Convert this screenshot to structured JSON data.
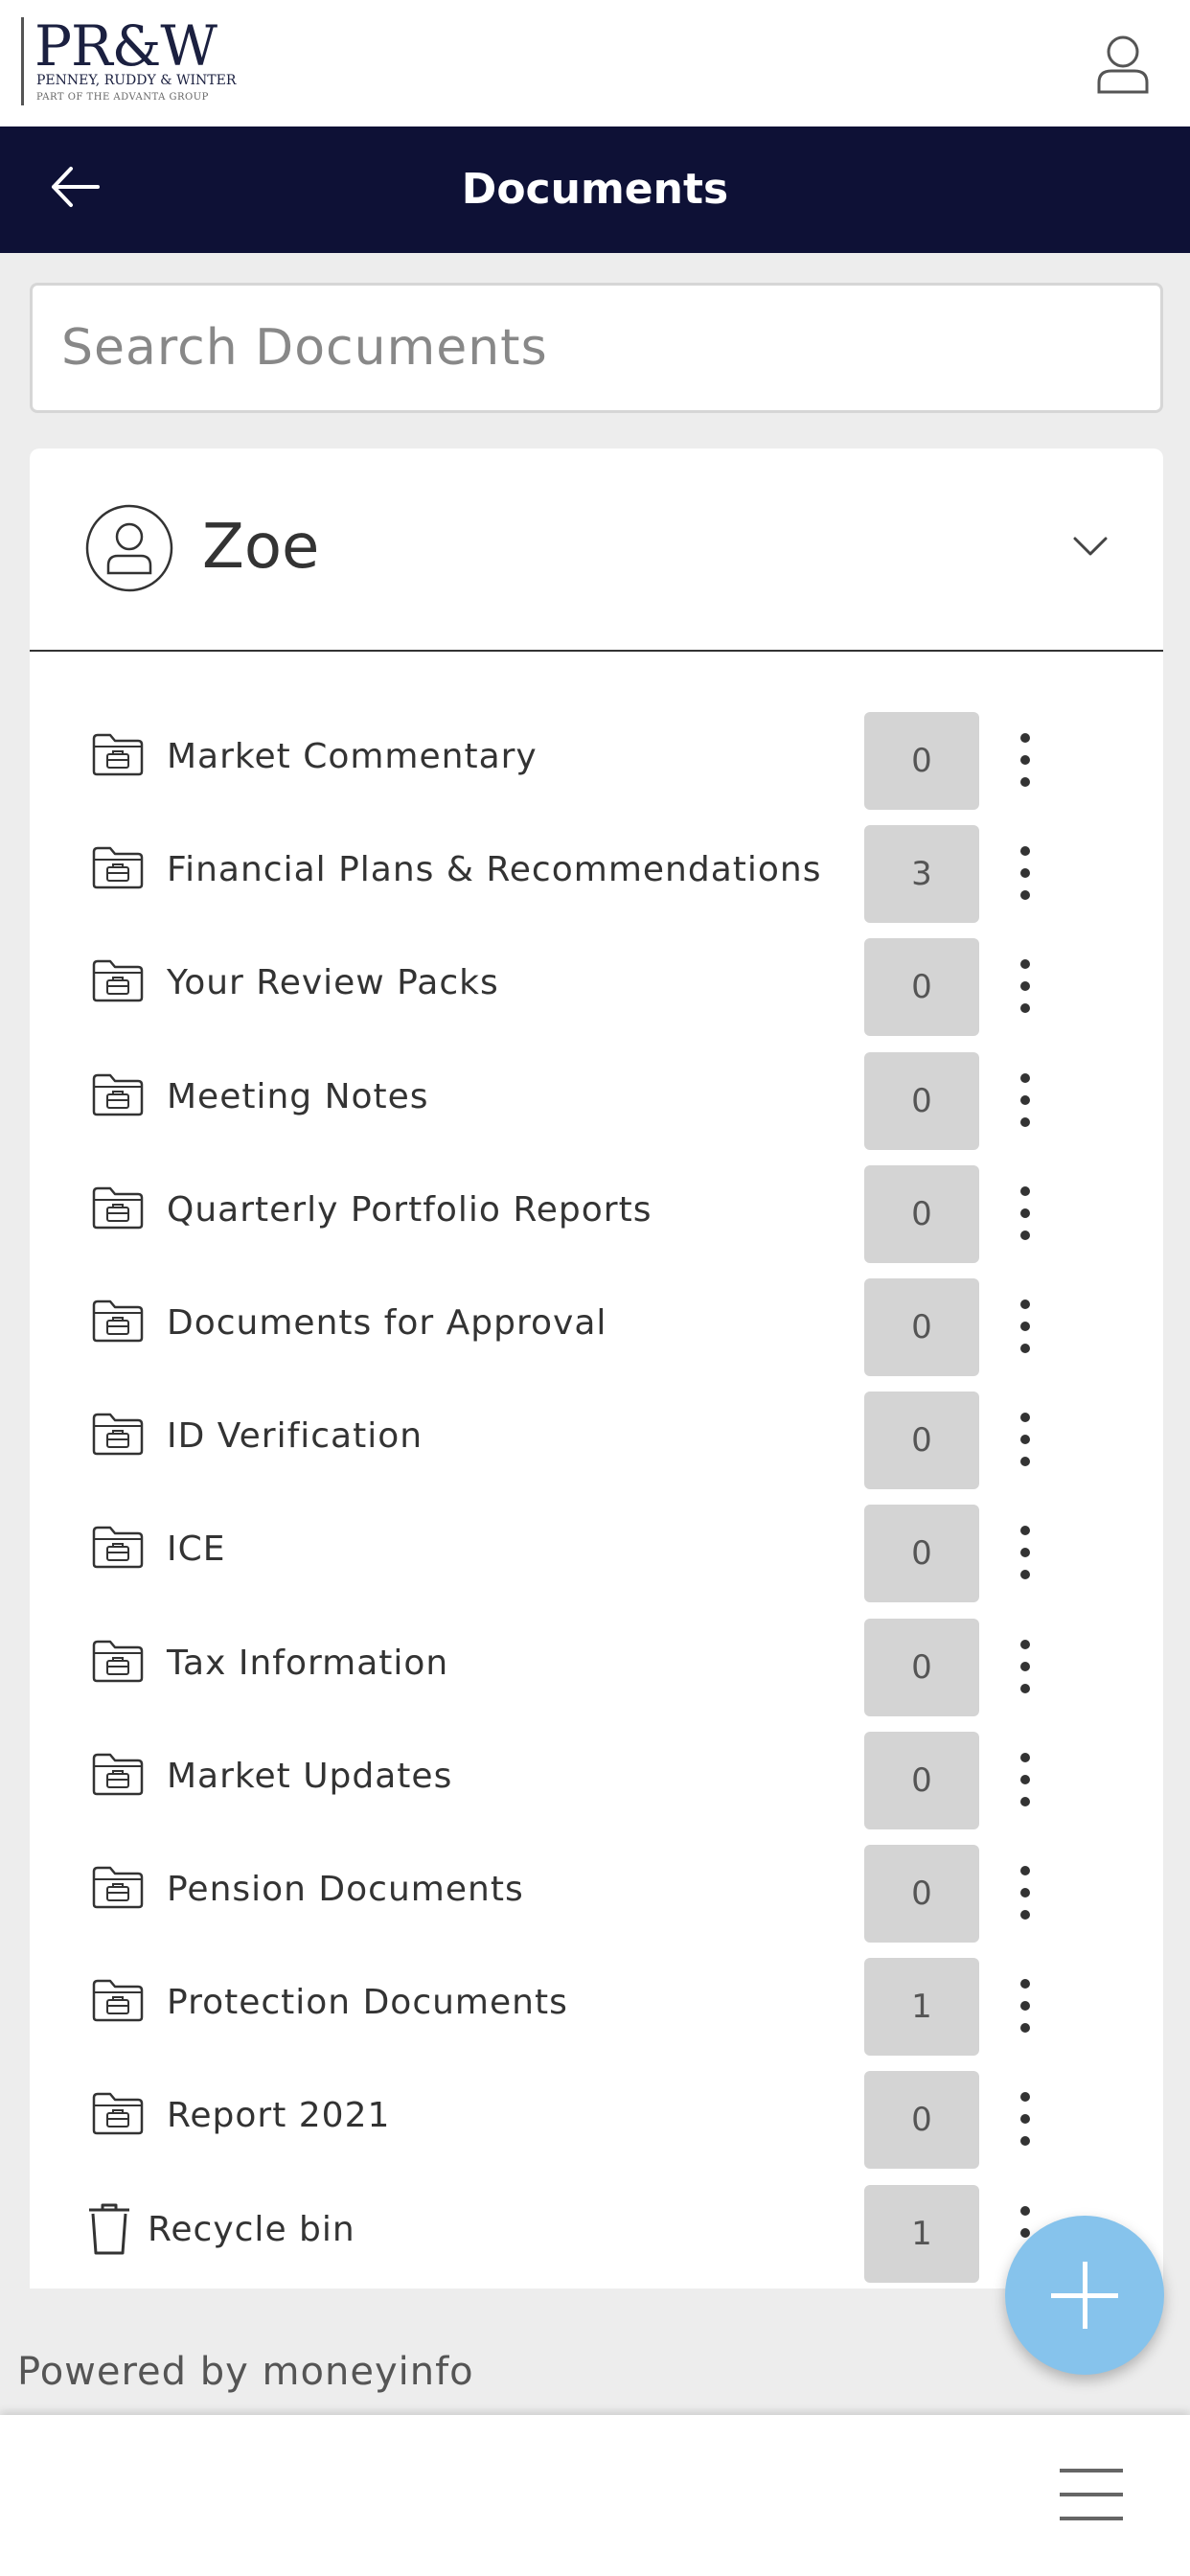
{
  "brand": {
    "logo_mark": "PR&W",
    "logo_line1": "PENNEY, RUDDY & WINTER",
    "logo_line2": "PART OF THE ADVANTA GROUP"
  },
  "header": {
    "title": "Documents"
  },
  "search": {
    "placeholder": "Search Documents",
    "value": ""
  },
  "profile": {
    "name": "Zoe"
  },
  "folders": [
    {
      "label": "Market Commentary",
      "count": "0",
      "icon": "folder-icon"
    },
    {
      "label": "Financial Plans & Recommendations",
      "count": "3",
      "icon": "folder-icon"
    },
    {
      "label": "Your Review Packs",
      "count": "0",
      "icon": "folder-icon"
    },
    {
      "label": "Meeting Notes",
      "count": "0",
      "icon": "folder-icon"
    },
    {
      "label": "Quarterly Portfolio Reports",
      "count": "0",
      "icon": "folder-icon"
    },
    {
      "label": "Documents for Approval",
      "count": "0",
      "icon": "folder-icon"
    },
    {
      "label": "ID Verification",
      "count": "0",
      "icon": "folder-icon"
    },
    {
      "label": "ICE",
      "count": "0",
      "icon": "folder-icon"
    },
    {
      "label": "Tax Information",
      "count": "0",
      "icon": "folder-icon"
    },
    {
      "label": "Market Updates",
      "count": "0",
      "icon": "folder-icon"
    },
    {
      "label": "Pension Documents",
      "count": "0",
      "icon": "folder-icon"
    },
    {
      "label": "Protection Documents",
      "count": "1",
      "icon": "folder-icon"
    },
    {
      "label": "Report 2021",
      "count": "0",
      "icon": "folder-icon"
    },
    {
      "label": "Recycle bin",
      "count": "1",
      "icon": "trash-icon"
    }
  ],
  "footer": {
    "powered_by": "Powered by moneyinfo"
  },
  "colors": {
    "header_bg": "#0e1136",
    "fab": "#86c3ec",
    "badge_bg": "#d4d4d4"
  }
}
